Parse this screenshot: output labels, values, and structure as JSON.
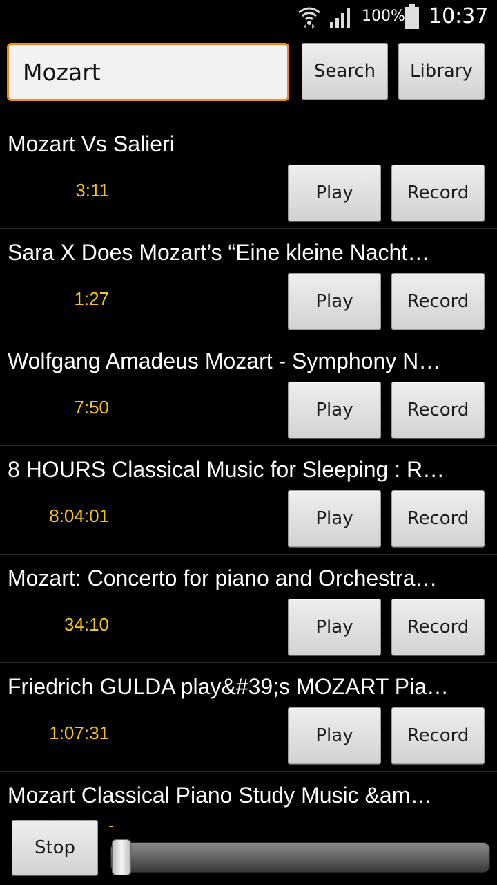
{
  "status_bar": {
    "battery": "100%",
    "time": "10:37"
  },
  "search": {
    "value": "Mozart",
    "search_label": "Search",
    "library_label": "Library"
  },
  "results": [
    {
      "title": "Mozart Vs Salieri",
      "duration": "3:11",
      "play_label": "Play",
      "record_label": "Record"
    },
    {
      "title": "Sara X Does Mozart’s  “Eine kleine Nacht…",
      "duration": "1:27",
      "play_label": "Play",
      "record_label": "Record"
    },
    {
      "title": "Wolfgang Amadeus Mozart - Symphony N…",
      "duration": "7:50",
      "play_label": "Play",
      "record_label": "Record"
    },
    {
      "title": "8 HOURS Classical Music for Sleeping : R…",
      "duration": "8:04:01",
      "play_label": "Play",
      "record_label": "Record"
    },
    {
      "title": "Mozart: Concerto for piano and Orchestra…",
      "duration": "34:10",
      "play_label": "Play",
      "record_label": "Record"
    },
    {
      "title": "Friedrich GULDA play&#39;s MOZART Pia…",
      "duration": "1:07:31",
      "play_label": "Play",
      "record_label": "Record"
    },
    {
      "title": "Mozart Classical Piano Study Music &am…"
    }
  ],
  "player": {
    "stop_label": "Stop",
    "position_label": "-",
    "progress": 0
  }
}
